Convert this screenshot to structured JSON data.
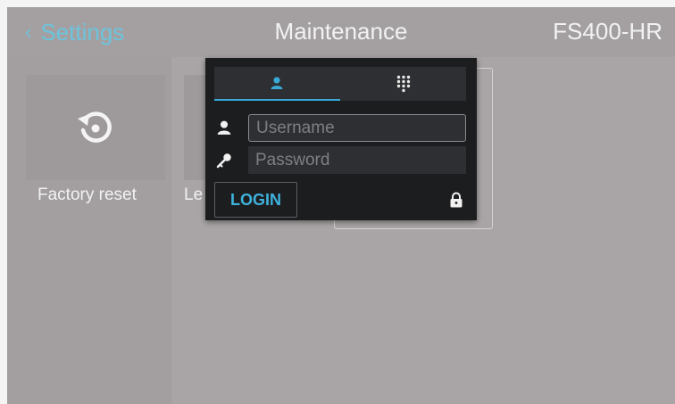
{
  "header": {
    "back_label": "Settings",
    "title": "Maintenance",
    "model": "FS400-HR"
  },
  "tiles": [
    {
      "label": "Factory reset",
      "icon": "restore-icon"
    },
    {
      "label": "Le",
      "icon": ""
    }
  ],
  "login_dialog": {
    "tabs": [
      {
        "icon": "user-icon",
        "selected": true
      },
      {
        "icon": "keypad-icon",
        "selected": false
      }
    ],
    "username": {
      "value": "",
      "placeholder": "Username",
      "icon": "user-icon"
    },
    "password": {
      "value": "",
      "placeholder": "Password",
      "icon": "key-icon"
    },
    "login_label": "LOGIN",
    "lock_icon": "lock-icon"
  },
  "colors": {
    "accent": "#39a9d6",
    "screen_bg": "#a9a5a6",
    "dialog_bg": "#1c1d1f",
    "field_bg": "#2d2f32"
  }
}
